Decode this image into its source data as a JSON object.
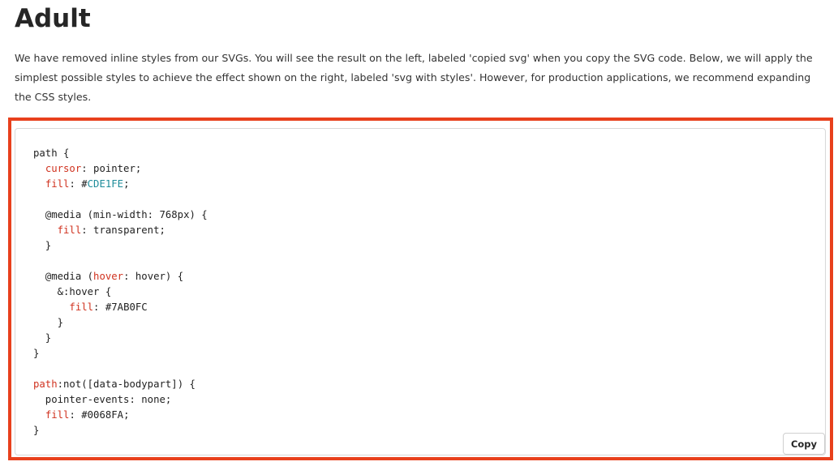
{
  "page": {
    "title": "Adult",
    "intro": "We have removed inline styles from our SVGs. You will see the result on the left, labeled 'copied svg' when you copy the SVG code. Below, we will apply the simplest possible styles to achieve the effect shown on the right, labeled 'svg with styles'. However, for production applications, we recommend expanding the CSS styles."
  },
  "code": {
    "lines": [
      [
        {
          "t": "path {"
        }
      ],
      [
        {
          "t": "  "
        },
        {
          "t": "cursor",
          "c": "prop"
        },
        {
          "t": ": pointer;"
        }
      ],
      [
        {
          "t": "  "
        },
        {
          "t": "fill",
          "c": "prop"
        },
        {
          "t": ": #"
        },
        {
          "t": "CDE1FE",
          "c": "hex"
        },
        {
          "t": ";"
        }
      ],
      [
        {
          "t": ""
        }
      ],
      [
        {
          "t": "  @media (min-width: 768px) {"
        }
      ],
      [
        {
          "t": "    "
        },
        {
          "t": "fill",
          "c": "prop"
        },
        {
          "t": ": transparent;"
        }
      ],
      [
        {
          "t": "  }"
        }
      ],
      [
        {
          "t": ""
        }
      ],
      [
        {
          "t": "  @media ("
        },
        {
          "t": "hover",
          "c": "prop"
        },
        {
          "t": ": hover) {"
        }
      ],
      [
        {
          "t": "    &:hover {"
        }
      ],
      [
        {
          "t": "      "
        },
        {
          "t": "fill",
          "c": "prop"
        },
        {
          "t": ": #7AB0FC"
        }
      ],
      [
        {
          "t": "    }"
        }
      ],
      [
        {
          "t": "  }"
        }
      ],
      [
        {
          "t": "}"
        }
      ],
      [
        {
          "t": ""
        }
      ],
      [
        {
          "t": "path",
          "c": "prop"
        },
        {
          "t": ":not([data-bodypart]) {"
        }
      ],
      [
        {
          "t": "  pointer-events: none;"
        }
      ],
      [
        {
          "t": "  "
        },
        {
          "t": "fill",
          "c": "prop"
        },
        {
          "t": ": #0068FA;"
        }
      ],
      [
        {
          "t": "}"
        }
      ]
    ],
    "copy_label": "Copy"
  },
  "colors": {
    "highlight_border": "#e8401c",
    "token_property": "#d0321f",
    "token_hex": "#1f8c9a"
  }
}
